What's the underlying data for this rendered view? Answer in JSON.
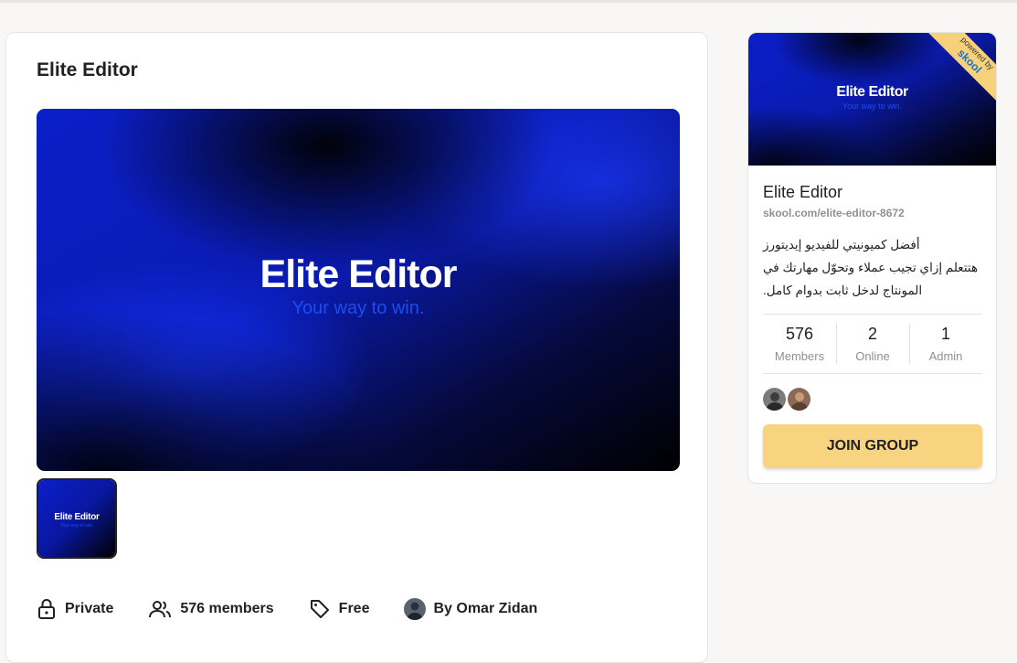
{
  "main": {
    "title": "Elite Editor",
    "hero": {
      "title": "Elite Editor",
      "tagline": "Your way to win."
    },
    "thumbnail": {
      "title": "Elite Editor",
      "tagline": "Your way to win."
    },
    "meta": {
      "privacy": {
        "icon": "lock-icon",
        "label": "Private"
      },
      "members": {
        "icon": "users-icon",
        "label": "576 members"
      },
      "price": {
        "icon": "tag-icon",
        "label": "Free"
      },
      "owner": {
        "label": "By Omar Zidan"
      }
    }
  },
  "sidebar": {
    "banner": {
      "title": "Elite Editor",
      "tagline": "Your way to win.",
      "ribbon_top": "powered by",
      "ribbon_brand": "skool"
    },
    "group_name": "Elite Editor",
    "url": "skool.com/elite-editor-8672",
    "description": "أفضل كميونيتي للفيديو إيديتورز\nهتتعلم إزاي تجيب عملاء وتحوّل مهارتك في المونتاج لدخل ثابت بدوام كامل.",
    "stats": [
      {
        "value": "576",
        "label": "Members"
      },
      {
        "value": "2",
        "label": "Online"
      },
      {
        "value": "1",
        "label": "Admin"
      }
    ],
    "join_label": "JOIN GROUP"
  },
  "colors": {
    "accent": "#f8d481",
    "hero_blue": "#0a24d8",
    "tagline_blue": "#1d4cf0"
  }
}
